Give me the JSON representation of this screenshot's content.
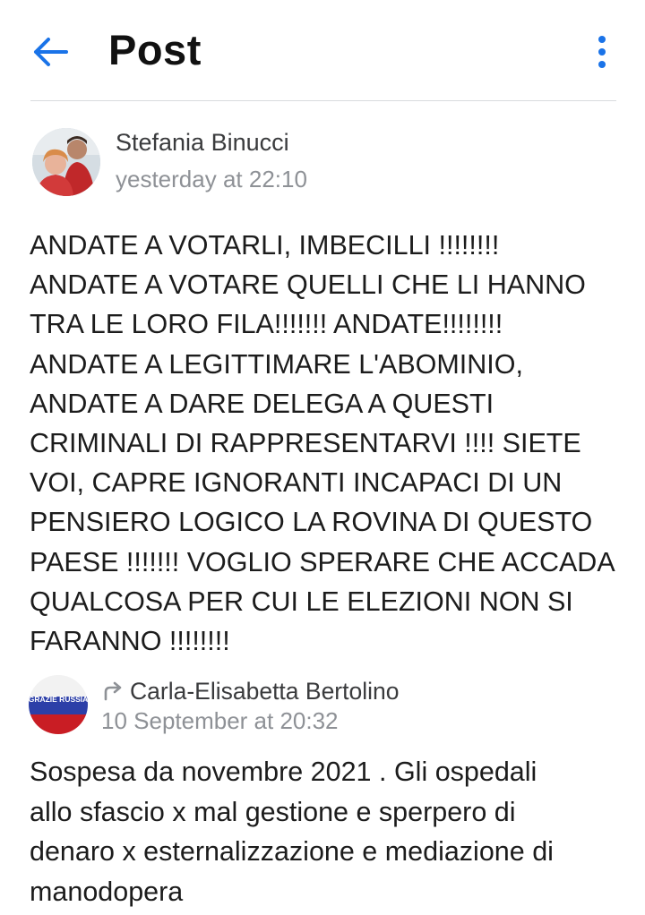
{
  "header": {
    "title": "Post",
    "back_icon": "arrow-left-icon",
    "menu_icon": "more-vertical-icon",
    "accent_color": "#1a73e8"
  },
  "post": {
    "author": "Stefania Binucci",
    "timestamp": "yesterday at 22:10",
    "body": "ANDATE A VOTARLI, IMBECILLI !!!!!!!!\nANDATE A VOTARE QUELLI CHE LI HANNO\nTRA LE LORO FILA!!!!!!! ANDATE!!!!!!!!\nANDATE A LEGITTIMARE L'ABOMINIO,\nANDATE A DARE DELEGA A QUESTI\nCRIMINALI DI RAPPRESENTARVI !!!! SIETE\nVOI, CAPRE IGNORANTI INCAPACI DI UN\nPENSIERO LOGICO LA ROVINA DI QUESTO\nPAESE !!!!!!! VOGLIO SPERARE CHE ACCADA\nQUALCOSA PER CUI LE ELEZIONI NON SI\nFARANNO !!!!!!!!"
  },
  "shared": {
    "share_icon": "share-arrow-icon",
    "author": "Carla-Elisabetta Bertolino",
    "avatar_text": "GRAZIE RUSSIA",
    "timestamp": "10 September at 20:32",
    "body": "Sospesa da novembre 2021 . Gli ospedali\nallo sfascio x mal gestione e sperpero di\ndenaro x esternalizzazione e mediazione di\nmanodopera"
  }
}
